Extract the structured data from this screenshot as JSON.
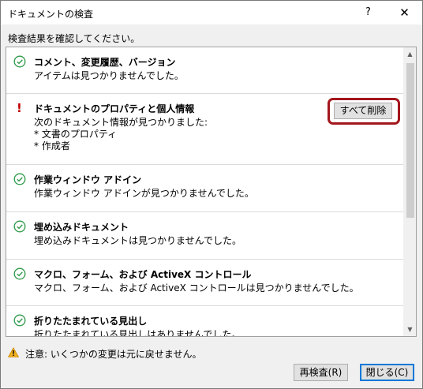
{
  "window": {
    "title": "ドキュメントの検査",
    "help_label": "?",
    "close_label": "✕"
  },
  "instruction": "検査結果を確認してください。",
  "items": [
    {
      "status": "ok",
      "status_icon": "check-circle-icon",
      "title": "コメント、変更履歴、バージョン",
      "lines": [
        "アイテムは見つかりませんでした。"
      ]
    },
    {
      "status": "found",
      "status_icon": "exclamation-icon",
      "title": "ドキュメントのプロパティと個人情報",
      "lines": [
        "次のドキュメント情報が見つかりました:",
        "* 文書のプロパティ",
        "* 作成者"
      ],
      "action_label": "すべて削除"
    },
    {
      "status": "ok",
      "status_icon": "check-circle-icon",
      "title": "作業ウィンドウ アドイン",
      "lines": [
        "作業ウィンドウ アドインが見つかりませんでした。"
      ]
    },
    {
      "status": "ok",
      "status_icon": "check-circle-icon",
      "title": "埋め込みドキュメント",
      "lines": [
        "埋め込みドキュメントは見つかりませんでした。"
      ]
    },
    {
      "status": "ok",
      "status_icon": "check-circle-icon",
      "title": "マクロ、フォーム、および ActiveX コントロール",
      "lines": [
        "マクロ、フォーム、および ActiveX コントロールは見つかりませんでした。"
      ]
    },
    {
      "status": "ok",
      "status_icon": "check-circle-icon",
      "title": "折りたたまれている見出し",
      "lines": [
        "折りたたまれている見出しはありませんでした。"
      ]
    }
  ],
  "footer": {
    "warning_icon": "warning-triangle-icon",
    "note": "注意: いくつかの変更は元に戻せません。",
    "reinspect_label": "再検査(R)",
    "close_label": "閉じる(C)"
  },
  "colors": {
    "check": "#2e9a4a",
    "alert": "#c00000",
    "highlight_border": "#a3161c",
    "default_button_border": "#0078d7",
    "warning": "#e8a317"
  }
}
